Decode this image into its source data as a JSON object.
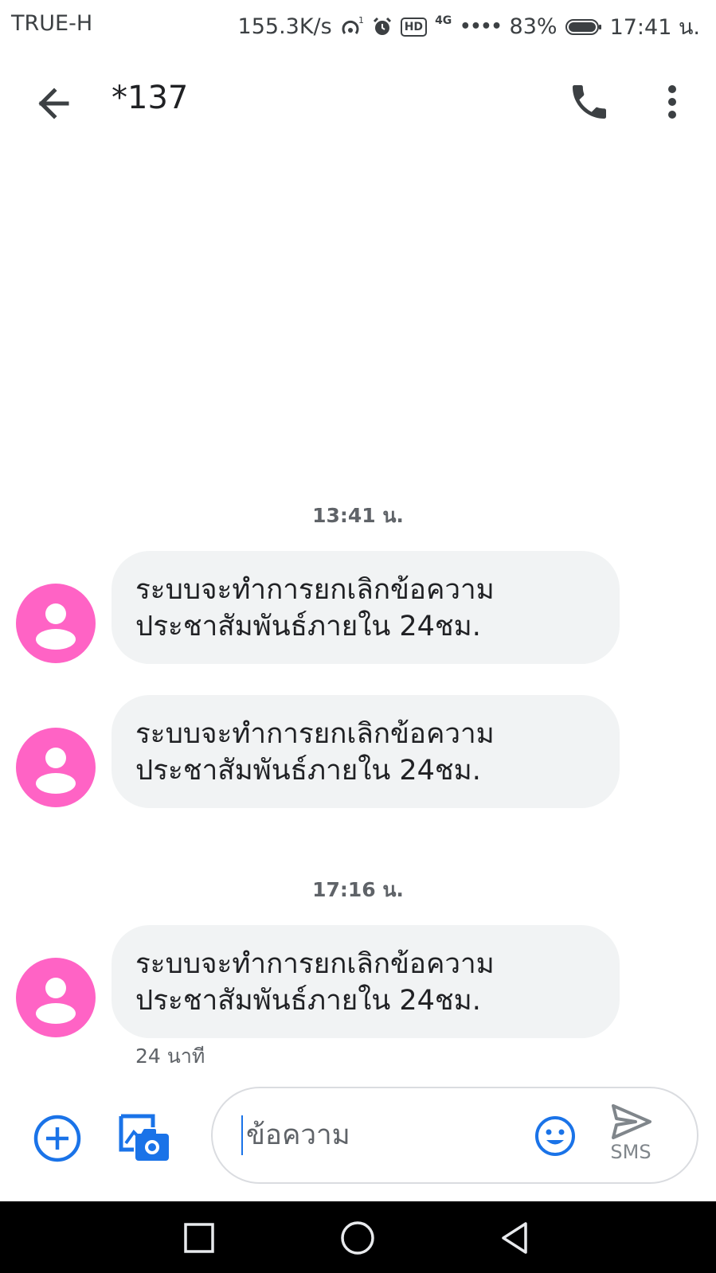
{
  "status_bar": {
    "carrier": "TRUE-H",
    "speed": "155.3K/s",
    "hotspot_count": "1",
    "hd_label": "HD",
    "network": "4G",
    "signal_dots": "••••",
    "battery": "83%",
    "time": "17:41 น."
  },
  "header": {
    "title": "*137"
  },
  "conversation": {
    "groups": [
      {
        "timestamp": "13:41 น.",
        "messages": [
          {
            "line1": "ระบบจะทำการยกเลิกข้อความ",
            "line2": "ประชาสัมพันธ์ภายใน 24ชม."
          },
          {
            "line1": "ระบบจะทำการยกเลิกข้อความ",
            "line2": "ประชาสัมพันธ์ภายใน 24ชม."
          }
        ]
      },
      {
        "timestamp": "17:16 น.",
        "messages": [
          {
            "line1": "ระบบจะทำการยกเลิกข้อความ",
            "line2": "ประชาสัมพันธ์ภายใน 24ชม.",
            "status": "24 นาที"
          }
        ]
      }
    ]
  },
  "compose": {
    "placeholder": "ข้อความ",
    "send_label": "SMS"
  },
  "colors": {
    "avatar": "#ff63c5",
    "accent": "#1a73e8",
    "bubble": "#f1f3f4"
  },
  "icons": {
    "back": "arrow-left-icon",
    "call": "phone-icon",
    "more": "more-vert-icon",
    "add": "add-circle-icon",
    "gallery": "gallery-camera-icon",
    "emoji": "emoji-icon",
    "send": "send-icon",
    "avatar": "person-icon",
    "nav_recents": "square-icon",
    "nav_home": "circle-icon",
    "nav_back": "triangle-icon"
  }
}
